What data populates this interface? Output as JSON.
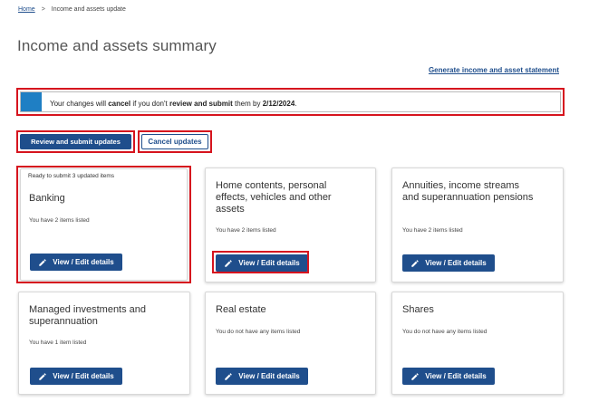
{
  "breadcrumb": {
    "home": "Home",
    "separator": ">",
    "current": "Income and assets update"
  },
  "page_title": "Income and assets summary",
  "statement_link": "Generate income and asset statement",
  "alert": {
    "part1": "Your changes will ",
    "bold1": "cancel",
    "part2": " if you don't ",
    "bold2": "review and submit",
    "part3": " them by ",
    "bold3": "2/12/2024",
    "part4": "."
  },
  "actions": {
    "review_label": "Review and submit updates",
    "cancel_label": "Cancel updates"
  },
  "cards": [
    {
      "status": "Ready to submit 3 updated items",
      "title": "Banking",
      "subtitle": "You have 2 items listed",
      "button": "View / Edit details"
    },
    {
      "status": "",
      "title": "Home contents, personal effects, vehicles and other assets",
      "subtitle": "You have 2 items listed",
      "button": "View / Edit details"
    },
    {
      "status": "",
      "title": "Annuities, income streams and superannuation pensions",
      "subtitle": "You have 2 items listed",
      "button": "View / Edit details"
    },
    {
      "status": "",
      "title": "Managed investments and superannuation",
      "subtitle": "You have 1 item listed",
      "button": "View / Edit details"
    },
    {
      "status": "",
      "title": "Real estate",
      "subtitle": "You do not have any items listed",
      "button": "View / Edit details"
    },
    {
      "status": "",
      "title": "Shares",
      "subtitle": "You do not have any items listed",
      "button": "View / Edit details"
    }
  ],
  "colors": {
    "brand": "#1f4e8c",
    "alert_bar": "#1f7fc4",
    "highlight": "#d6141e"
  },
  "icons": {
    "edit": "pencil-icon"
  }
}
